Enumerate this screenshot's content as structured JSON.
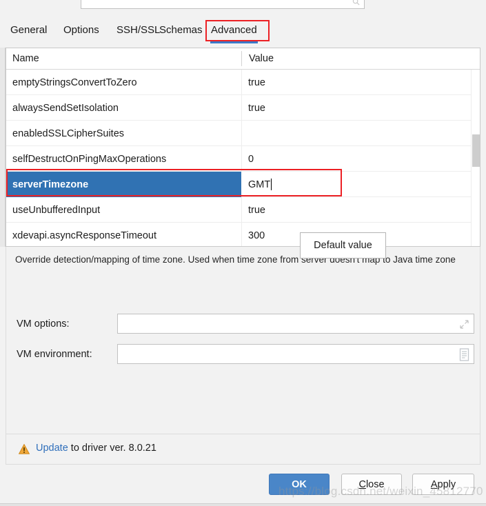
{
  "search": {
    "placeholder": "",
    "value": "",
    "icon": "search-icon"
  },
  "tabs": [
    {
      "label": "General",
      "selected": false
    },
    {
      "label": "Options",
      "selected": false
    },
    {
      "label": "SSH/SSL",
      "selected": false
    },
    {
      "label": "Schemas",
      "selected": false
    },
    {
      "label": "Advanced",
      "selected": true,
      "annotated": true
    }
  ],
  "table": {
    "columns": [
      "Name",
      "Value"
    ],
    "rows": [
      {
        "name": "emptyStringsConvertToZero",
        "value": "true",
        "selected": false
      },
      {
        "name": "alwaysSendSetIsolation",
        "value": "true",
        "selected": false
      },
      {
        "name": "enabledSSLCipherSuites",
        "value": "",
        "selected": false
      },
      {
        "name": "selfDestructOnPingMaxOperations",
        "value": "0",
        "selected": false
      },
      {
        "name": "serverTimezone",
        "value": "GMT",
        "selected": true,
        "editing": true,
        "annotated": true
      },
      {
        "name": "useUnbufferedInput",
        "value": "true",
        "selected": false
      },
      {
        "name": "xdevapi.asyncResponseTimeout",
        "value": "300",
        "selected": false
      }
    ]
  },
  "tooltip": {
    "text": "Default value"
  },
  "description": "Override detection/mapping of time zone. Used when time zone from server doesn't map to Java time zone",
  "vm": {
    "options_label": "VM options:",
    "options_value": "",
    "options_icon": "expand-icon",
    "environment_label": "VM environment:",
    "environment_value": "",
    "environment_icon": "document-list-icon"
  },
  "update": {
    "icon": "warning-triangle-icon",
    "link_label": "Update",
    "rest_text": " to driver ver. 8.0.21"
  },
  "buttons": {
    "ok": {
      "label": "OK",
      "primary": true
    },
    "close": {
      "label": "Close",
      "mnemonic": "C"
    },
    "apply": {
      "label": "Apply",
      "mnemonic": "A"
    }
  },
  "watermark": "https://blog.csdn.net/weixin_45812770",
  "colors": {
    "accent": "#3072b3",
    "primary_button": "#4a86c8",
    "annotation": "#ec2024",
    "link": "#2f6fbb",
    "warning": "#e8a33d",
    "tab_indicator": "#3c79c8"
  }
}
